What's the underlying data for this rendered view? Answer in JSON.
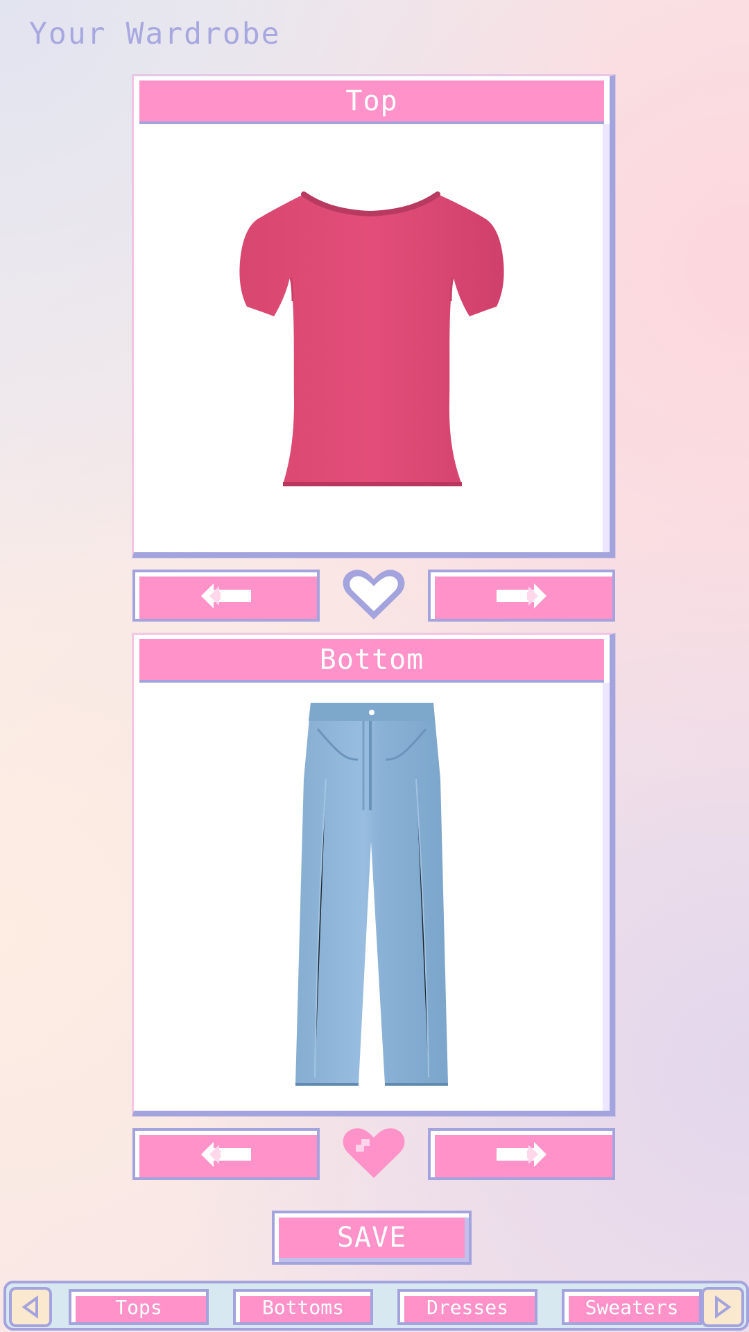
{
  "header": {
    "title": "Your Wardrobe"
  },
  "top_panel": {
    "label": "Top",
    "item_icon": "t-shirt-icon"
  },
  "bottom_panel": {
    "label": "Bottom",
    "item_icon": "jeans-icon"
  },
  "buttons": {
    "save_label": "SAVE",
    "prev_icon": "left-arrow-icon",
    "next_icon": "right-arrow-icon",
    "heart_icon": "heart-icon"
  },
  "favorites": {
    "top_liked": false,
    "bottom_liked": true
  },
  "categories": [
    "Tops",
    "Bottoms",
    "Dresses",
    "Sweaters"
  ],
  "colors": {
    "accent_pink": "#ff92c9",
    "accent_purple": "#a3a3dd",
    "top_item": "#df4b78",
    "bottom_item": "#8fb7d9"
  }
}
